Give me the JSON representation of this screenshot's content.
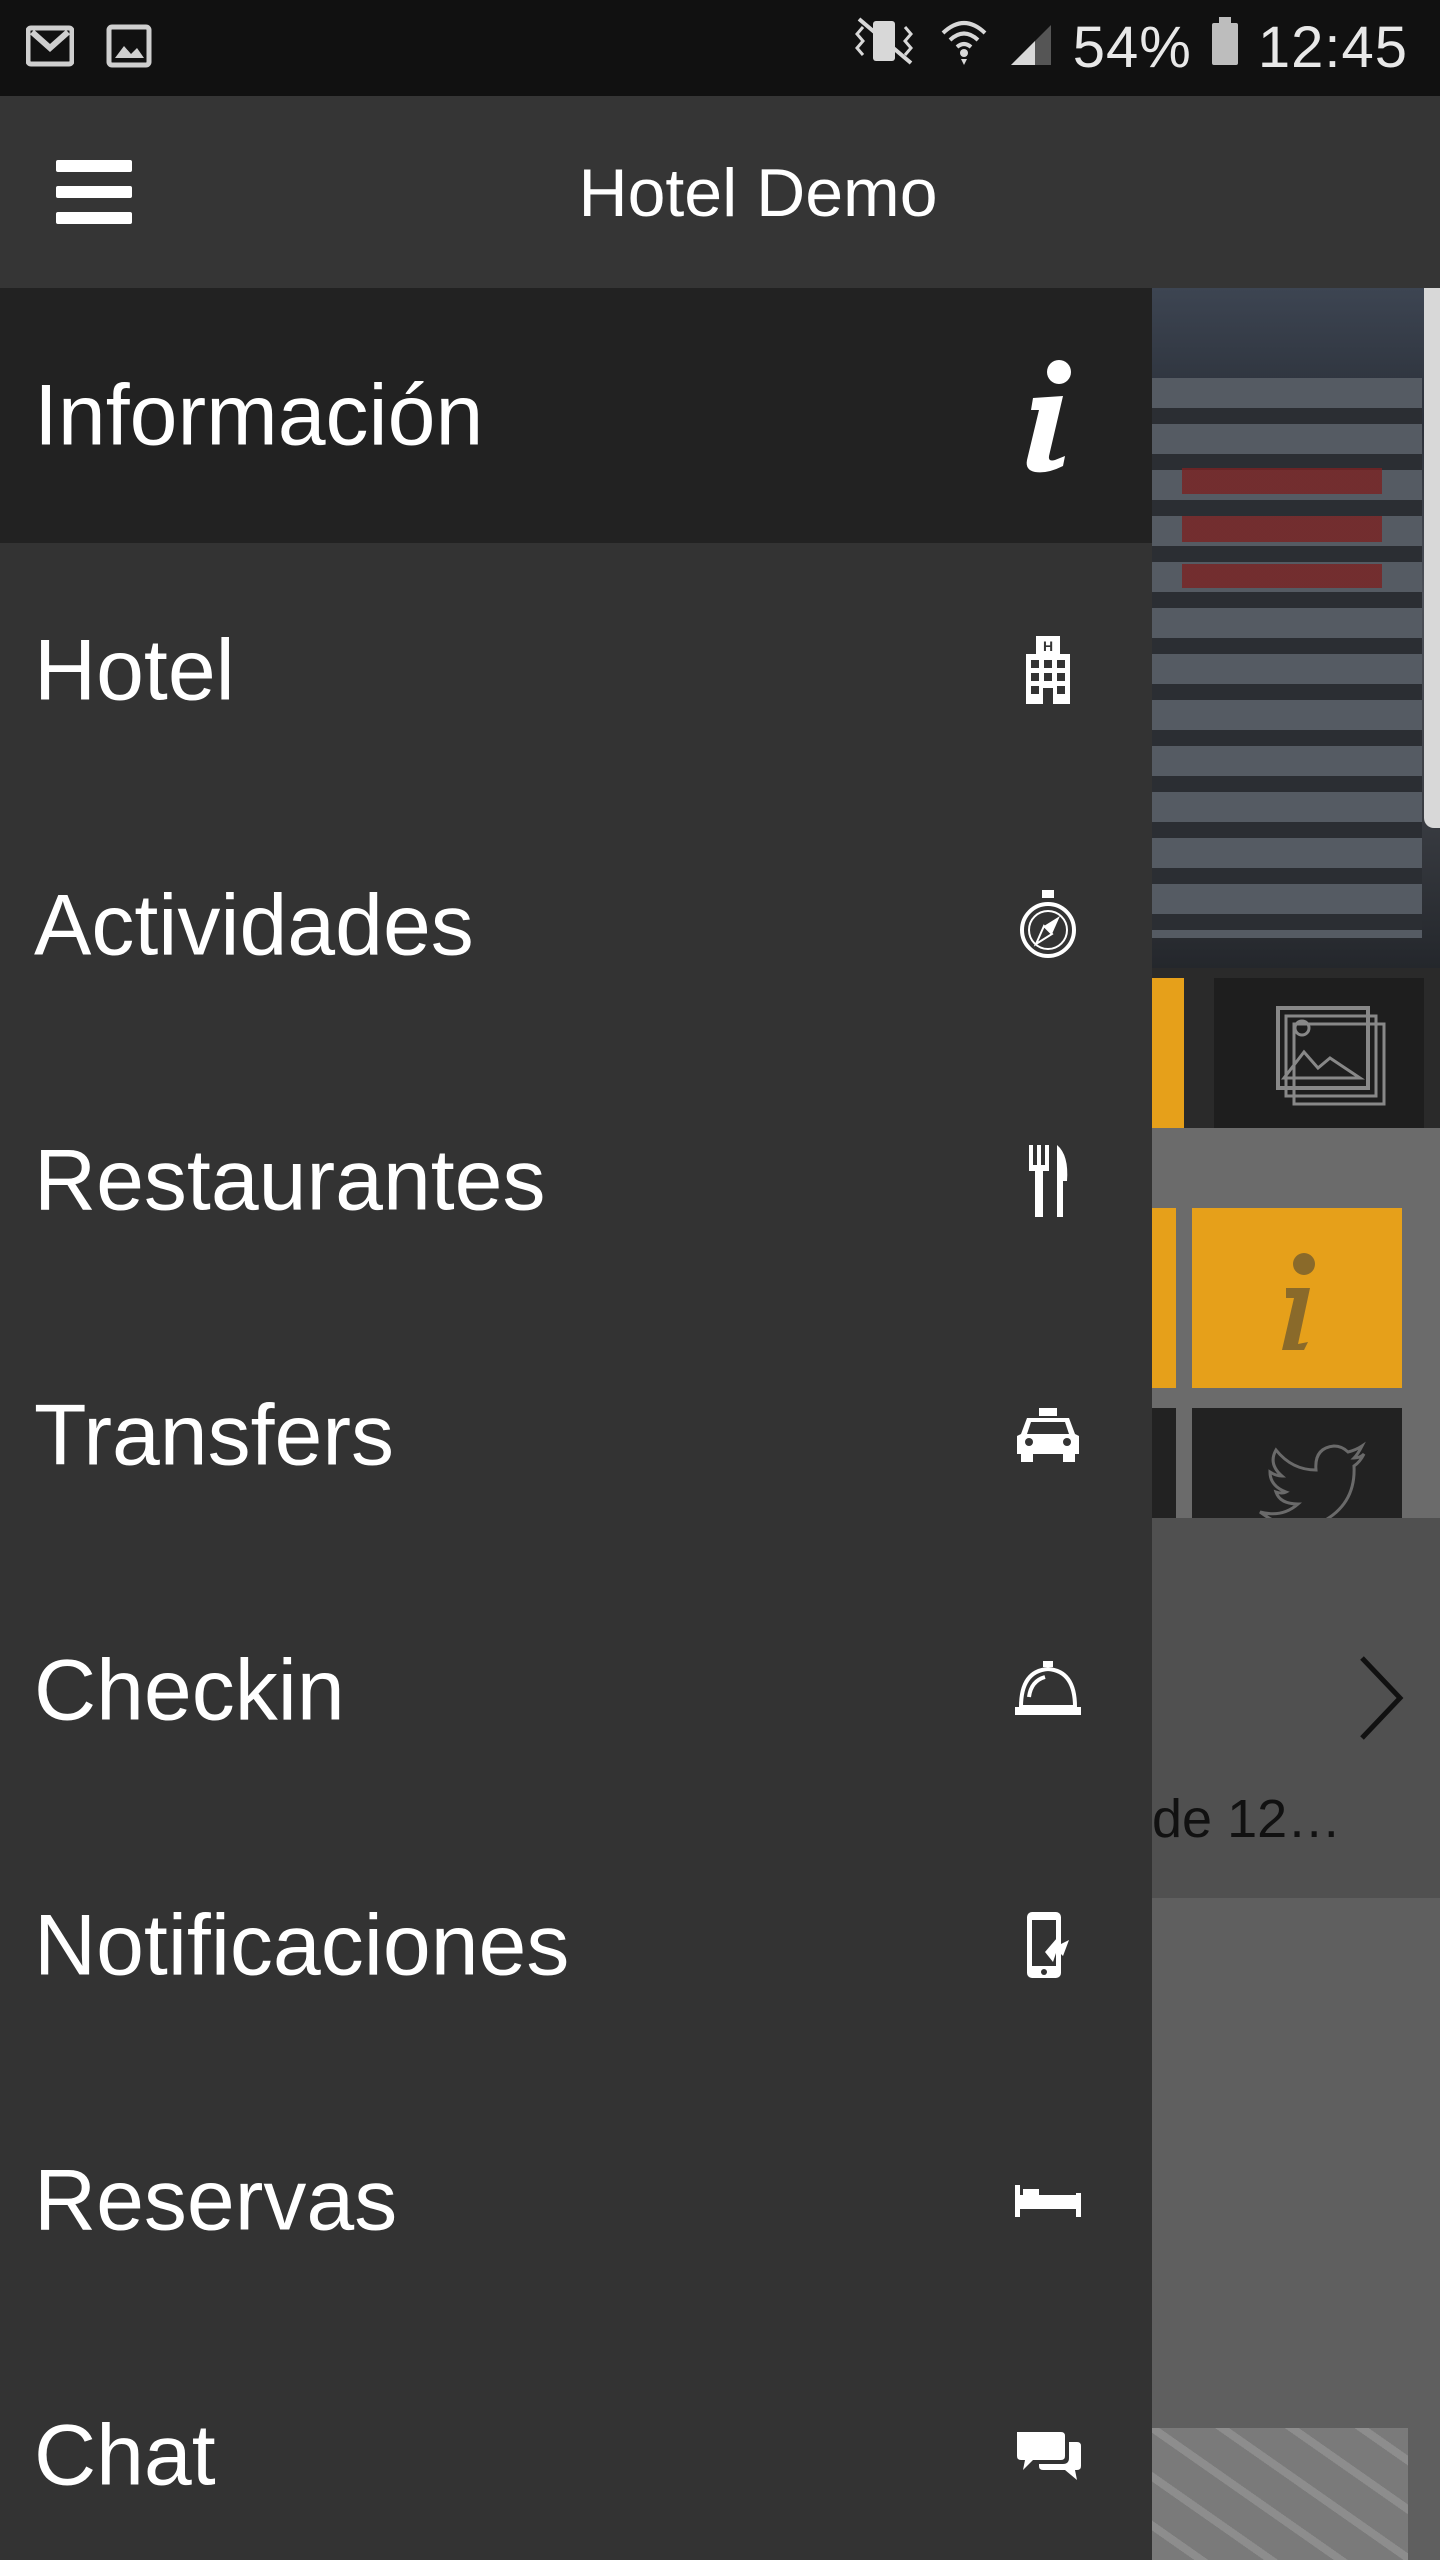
{
  "status_bar": {
    "battery_percent": "54%",
    "time": "12:45",
    "left_icons": [
      "gmail-icon",
      "image-icon"
    ],
    "right_icons": [
      "vibrate-icon",
      "wifi-icon",
      "signal-icon",
      "battery-icon"
    ]
  },
  "app_bar": {
    "title": "Hotel Demo",
    "menu_icon": "hamburger-icon"
  },
  "colors": {
    "drawer_bg": "#333333",
    "active_bg": "#222222",
    "appbar_bg": "#353535",
    "accent": "#e6a01a"
  },
  "menu": {
    "items": [
      {
        "label": "Información",
        "icon": "info-icon"
      },
      {
        "label": "Hotel",
        "icon": "hotel-building-icon"
      },
      {
        "label": "Actividades",
        "icon": "compass-icon"
      },
      {
        "label": "Restaurantes",
        "icon": "fork-knife-icon"
      },
      {
        "label": "Transfers",
        "icon": "taxi-icon"
      },
      {
        "label": "Checkin",
        "icon": "service-bell-icon"
      },
      {
        "label": "Notificaciones",
        "icon": "phone-notification-icon"
      },
      {
        "label": "Reservas",
        "icon": "bed-icon"
      },
      {
        "label": "Chat",
        "icon": "chat-bubbles-icon"
      }
    ]
  },
  "background": {
    "list_snippet": "de 12…"
  }
}
